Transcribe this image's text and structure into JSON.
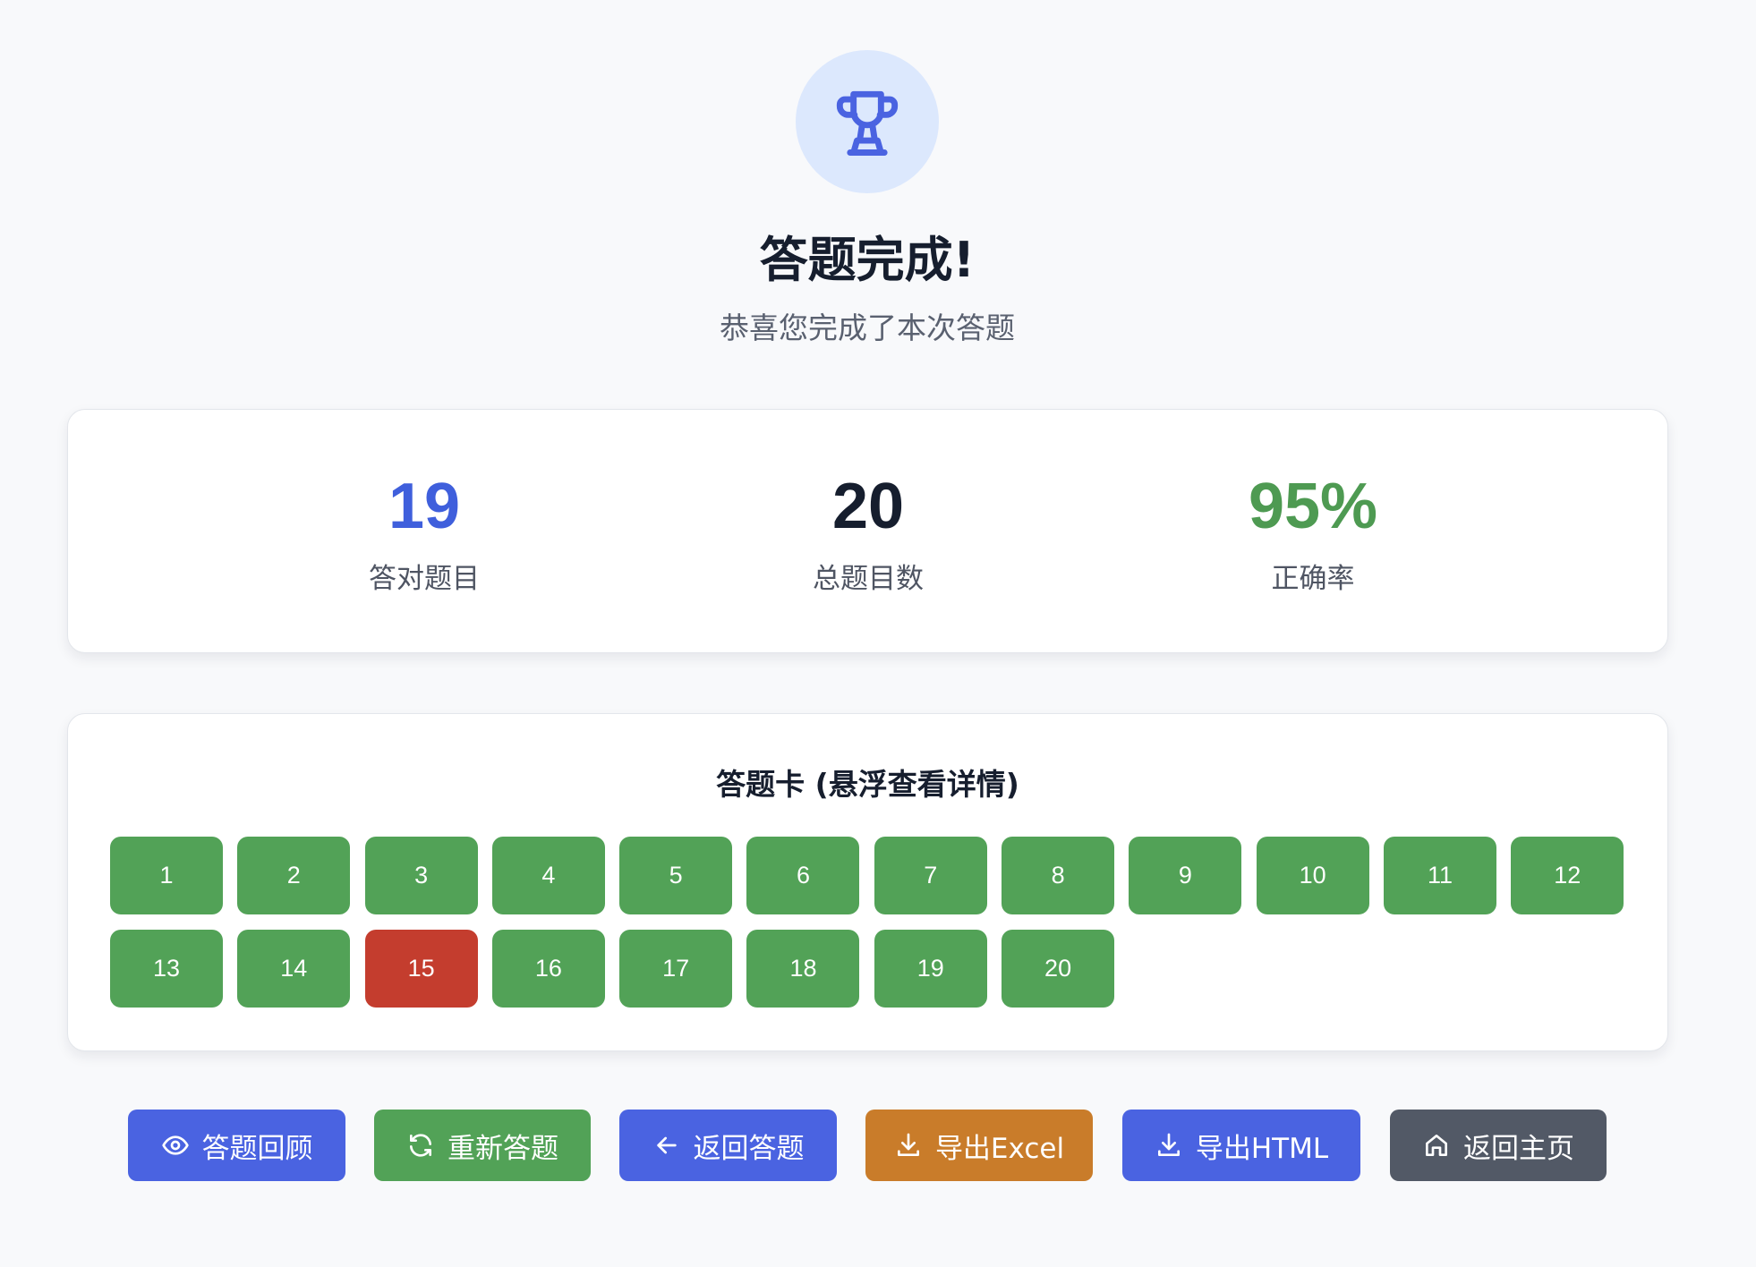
{
  "header": {
    "icon": "trophy-icon",
    "title": "答题完成!",
    "subtitle": "恭喜您完成了本次答题"
  },
  "stats": [
    {
      "value": "19",
      "label": "答对题目",
      "color": "#3f5fdc"
    },
    {
      "value": "20",
      "label": "总题目数",
      "color": "#161e2e"
    },
    {
      "value": "95%",
      "label": "正确率",
      "color": "#4e9a52"
    }
  ],
  "answer_card": {
    "title": "答题卡 (悬浮查看详情)",
    "items": [
      {
        "label": "1",
        "status": "correct"
      },
      {
        "label": "2",
        "status": "correct"
      },
      {
        "label": "3",
        "status": "correct"
      },
      {
        "label": "4",
        "status": "correct"
      },
      {
        "label": "5",
        "status": "correct"
      },
      {
        "label": "6",
        "status": "correct"
      },
      {
        "label": "7",
        "status": "correct"
      },
      {
        "label": "8",
        "status": "correct"
      },
      {
        "label": "9",
        "status": "correct"
      },
      {
        "label": "10",
        "status": "correct"
      },
      {
        "label": "11",
        "status": "correct"
      },
      {
        "label": "12",
        "status": "correct"
      },
      {
        "label": "13",
        "status": "correct"
      },
      {
        "label": "14",
        "status": "correct"
      },
      {
        "label": "15",
        "status": "wrong"
      },
      {
        "label": "16",
        "status": "correct"
      },
      {
        "label": "17",
        "status": "correct"
      },
      {
        "label": "18",
        "status": "correct"
      },
      {
        "label": "19",
        "status": "correct"
      },
      {
        "label": "20",
        "status": "correct"
      }
    ],
    "colors": {
      "correct": "#52a257",
      "wrong": "#c43d2e"
    }
  },
  "actions": [
    {
      "label": "答题回顾",
      "icon": "eye-icon",
      "color": "#4a63e1"
    },
    {
      "label": "重新答题",
      "icon": "refresh-icon",
      "color": "#52a257"
    },
    {
      "label": "返回答题",
      "icon": "arrow-left-icon",
      "color": "#4a63e1"
    },
    {
      "label": "导出Excel",
      "icon": "download-icon",
      "color": "#c97c2a"
    },
    {
      "label": "导出HTML",
      "icon": "download-icon",
      "color": "#4a63e1"
    },
    {
      "label": "返回主页",
      "icon": "home-icon",
      "color": "#525966"
    }
  ]
}
